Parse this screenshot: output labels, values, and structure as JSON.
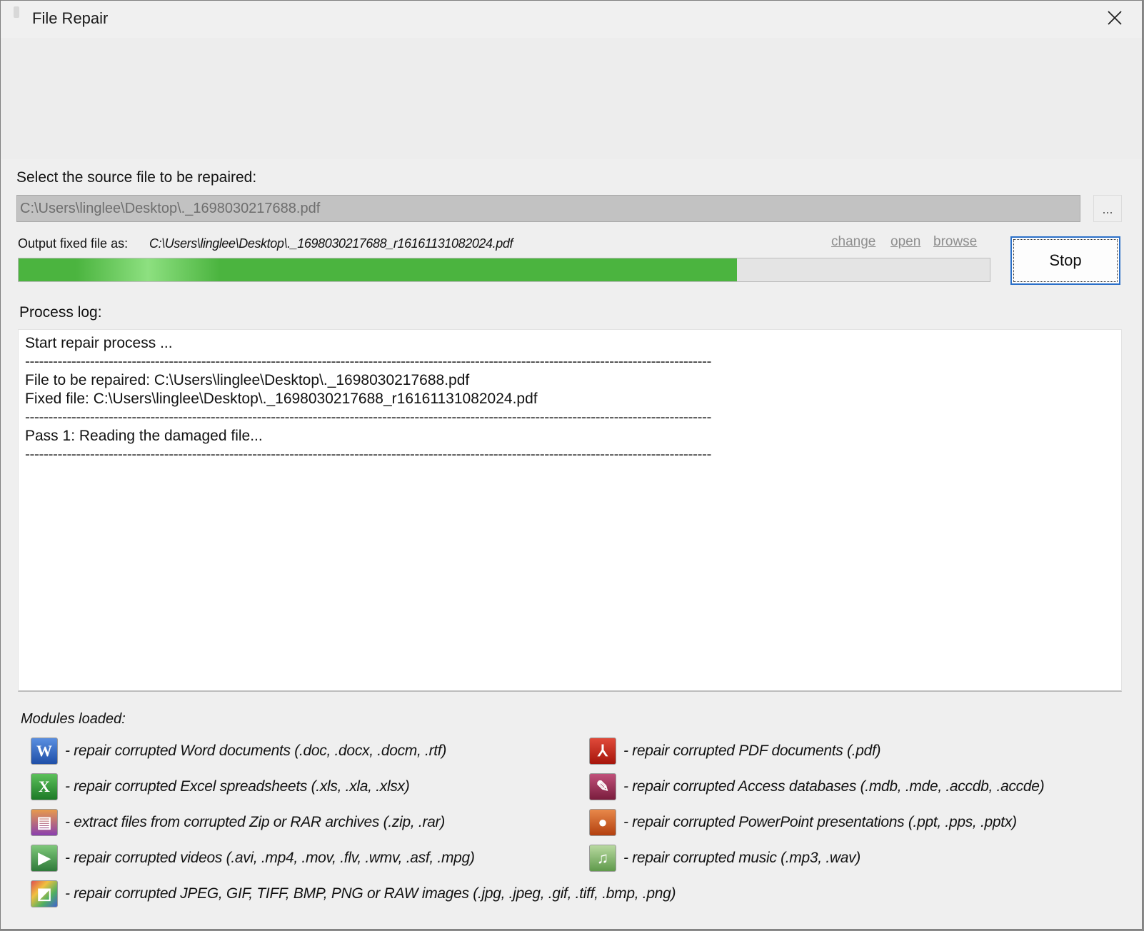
{
  "window": {
    "title": "File Repair",
    "close_glyph": "✕"
  },
  "source": {
    "label": "Select the source file to be repaired:",
    "value": "C:\\Users\\linglee\\Desktop\\._1698030217688.pdf",
    "browse_label": "..."
  },
  "output": {
    "label": "Output fixed file as:",
    "path": "C:\\Users\\linglee\\Desktop\\._1698030217688_r16161131082024.pdf",
    "links": {
      "change": "change",
      "open": "open",
      "browse": "browse"
    }
  },
  "progress": {
    "value_percent": 74,
    "color": "#4bb43f"
  },
  "stop_button": {
    "label": "Stop"
  },
  "log": {
    "label": "Process log:",
    "lines": [
      "Start repair process ...",
      "----------------------------------------------------------------------------------------------------------------------------------------------------",
      "File to be repaired: C:\\Users\\linglee\\Desktop\\._1698030217688.pdf",
      "Fixed file: C:\\Users\\linglee\\Desktop\\._1698030217688_r16161131082024.pdf",
      "----------------------------------------------------------------------------------------------------------------------------------------------------",
      "Pass 1: Reading the damaged file...",
      "----------------------------------------------------------------------------------------------------------------------------------------------------"
    ]
  },
  "modules": {
    "title": "Modules loaded:",
    "items": [
      {
        "icon": "word-icon",
        "text": "- repair corrupted Word documents (.doc, .docx, .docm, .rtf)"
      },
      {
        "icon": "pdf-icon",
        "text": "- repair corrupted PDF documents (.pdf)"
      },
      {
        "icon": "excel-icon",
        "text": "- repair corrupted Excel spreadsheets (.xls, .xla, .xlsx)"
      },
      {
        "icon": "access-icon",
        "text": "- repair corrupted Access databases (.mdb, .mde, .accdb, .accde)"
      },
      {
        "icon": "archive-icon",
        "text": "- extract files from corrupted Zip or RAR archives (.zip, .rar)"
      },
      {
        "icon": "powerpoint-icon",
        "text": "- repair corrupted PowerPoint presentations (.ppt, .pps, .pptx)"
      },
      {
        "icon": "video-icon",
        "text": "- repair corrupted videos (.avi, .mp4, .mov, .flv, .wmv, .asf, .mpg)"
      },
      {
        "icon": "music-icon",
        "text": "- repair corrupted music (.mp3, .wav)"
      },
      {
        "icon": "image-icon",
        "text": "- repair corrupted JPEG, GIF, TIFF, BMP, PNG or RAW images (.jpg, .jpeg, .gif, .tiff, .bmp, .png)"
      }
    ]
  }
}
